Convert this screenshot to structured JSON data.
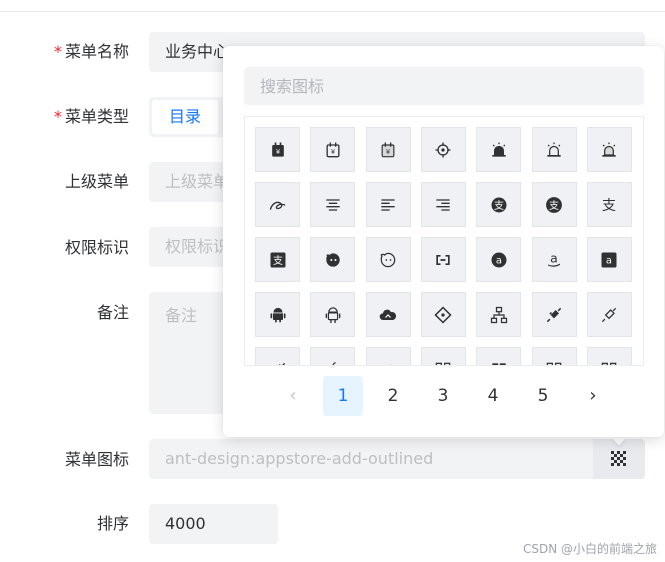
{
  "form": {
    "menu_name": {
      "label": "菜单名称",
      "value": "业务中心"
    },
    "menu_type": {
      "label": "菜单类型",
      "selected": "目录"
    },
    "parent_menu": {
      "label": "上级菜单",
      "placeholder": "上级菜单"
    },
    "permission": {
      "label": "权限标识",
      "placeholder": "权限标识"
    },
    "remark": {
      "label": "备注",
      "placeholder": "备注"
    },
    "menu_icon": {
      "label": "菜单图标",
      "placeholder": "ant-design:appstore-add-outlined"
    },
    "sort": {
      "label": "排序",
      "value": "4000"
    },
    "required_mark": "*"
  },
  "icon_picker": {
    "search_placeholder": "搜索图标",
    "icons": [
      [
        "alert-filled-icon",
        "alert-outlined-icon",
        "alert-twotone-icon",
        "aim-icon",
        "alert-bell-filled-icon",
        "alert-bell-outlined-icon",
        "alert-bell-twotone-icon"
      ],
      [
        "aliwangwang-icon",
        "align-center-icon",
        "align-left-icon",
        "align-right-icon",
        "alipay-circle-filled-icon",
        "alipay-circle-outlined-icon",
        "alipay-icon"
      ],
      [
        "alipay-square-filled-icon",
        "aliwangwang-filled-icon",
        "aliwangwang-outlined-icon",
        "aliyun-icon",
        "amazon-circle-filled-icon",
        "amazon-icon",
        "amazon-square-filled-icon"
      ],
      [
        "android-filled-icon",
        "android-outlined-icon",
        "ant-cloud-icon",
        "ant-design-icon",
        "apartment-icon",
        "api-filled-icon",
        "api-outlined-icon"
      ],
      [
        "api-twotone-icon",
        "apple-filled-icon",
        "apple-outlined-icon",
        "appstore-add-icon",
        "appstore-filled-icon",
        "appstore-outlined-icon",
        "appstore-twotone-icon"
      ]
    ],
    "pagination": {
      "prev": "‹",
      "next": "›",
      "pages": [
        "1",
        "2",
        "3",
        "4",
        "5"
      ],
      "current": "1"
    }
  },
  "watermark": "CSDN @小白的前端之旅",
  "colors": {
    "accent": "#1677ff",
    "required": "#f5222d",
    "icon": "#303133"
  }
}
